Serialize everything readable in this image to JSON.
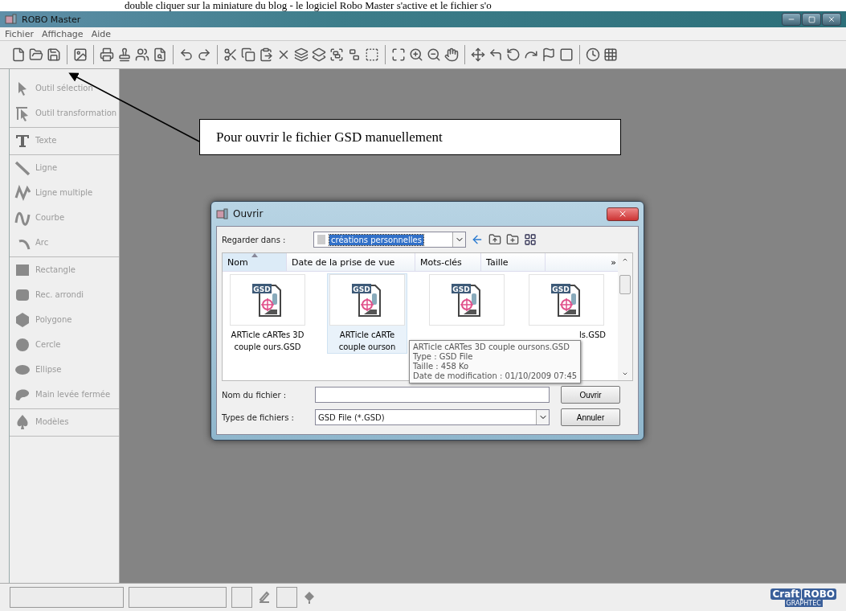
{
  "caption": "double cliquer sur la miniature du blog - le logiciel Robo Master s'active et le fichier s'o",
  "window": {
    "title": "ROBO Master"
  },
  "menu": [
    "Fichier",
    "Affichage",
    "Aide"
  ],
  "tool_groups": [
    {
      "items": [
        {
          "label": "Outil sélection",
          "kind": "pointer",
          "disabled": true
        },
        {
          "label": "Outil transformation",
          "kind": "transform",
          "disabled": true
        }
      ]
    },
    {
      "items": [
        {
          "label": "Texte",
          "kind": "text",
          "disabled": true
        }
      ]
    },
    {
      "items": [
        {
          "label": "Ligne",
          "kind": "line",
          "disabled": true
        },
        {
          "label": "Ligne multiple",
          "kind": "polyline",
          "disabled": true
        },
        {
          "label": "Courbe",
          "kind": "curve",
          "disabled": true
        },
        {
          "label": "Arc",
          "kind": "arc",
          "disabled": true
        }
      ]
    },
    {
      "items": [
        {
          "label": "Rectangle",
          "kind": "rect",
          "disabled": true
        },
        {
          "label": "Rec. arrondi",
          "kind": "roundrect",
          "disabled": true
        },
        {
          "label": "Polygone",
          "kind": "polygon",
          "disabled": true
        },
        {
          "label": "Cercle",
          "kind": "circle",
          "disabled": true
        },
        {
          "label": "Ellipse",
          "kind": "ellipse",
          "disabled": true
        },
        {
          "label": "Main levée fermée",
          "kind": "blob",
          "disabled": true
        }
      ]
    },
    {
      "items": [
        {
          "label": "Modèles",
          "kind": "spade",
          "disabled": true
        }
      ]
    }
  ],
  "annotation": {
    "text": "Pour ouvrir le fichier GSD manuellement"
  },
  "dialog": {
    "title": "Ouvrir",
    "look_in_label": "Regarder dans :",
    "look_in_value": "créations personnelles",
    "columns": [
      {
        "label": "Nom",
        "sorted": true
      },
      {
        "label": "Date de la prise de vue",
        "sorted": false
      },
      {
        "label": "Mots-clés",
        "sorted": false
      },
      {
        "label": "Taille",
        "sorted": false
      }
    ],
    "more_columns": "»",
    "files": [
      {
        "badge": "GSD",
        "name_lines": [
          "ARTicle cARTes 3D",
          "couple ours.GSD"
        ],
        "selected": false
      },
      {
        "badge": "GSD",
        "name_lines": [
          "ARTicle cARTe",
          "couple ourson"
        ],
        "selected": true
      },
      {
        "badge": "GSD",
        "selected": false
      },
      {
        "badge": "GSD",
        "name_lines": [
          "ls.GSD"
        ],
        "selected": false
      }
    ],
    "tooltip": [
      "ARTicle cARTes 3D couple oursons.GSD",
      "Type : GSD File",
      "Taille : 458 Ko",
      "Date de modification : 01/10/2009 07:45"
    ],
    "filename_label": "Nom du fichier :",
    "filetype_label": "Types de fichiers :",
    "filetype_value": "GSD File (*.GSD)",
    "buttons": [
      "Ouvrir",
      "Annuler"
    ]
  },
  "logo": {
    "left": "Craft",
    "right": "ROBO",
    "sub": "GRAPHTEC"
  }
}
